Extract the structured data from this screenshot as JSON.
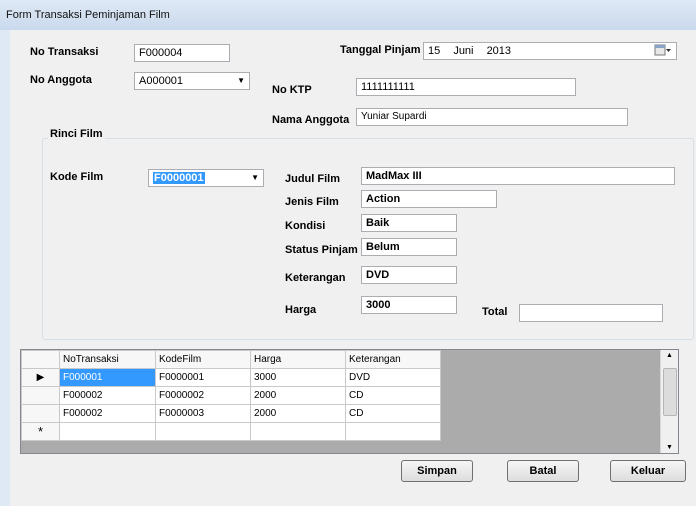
{
  "window": {
    "title": "Form Transaksi Peminjaman Film"
  },
  "form": {
    "no_transaksi_label": "No Transaksi",
    "no_transaksi_value": "F000004",
    "tanggal_label": "Tanggal Pinjam",
    "tanggal_day": "15",
    "tanggal_month": "Juni",
    "tanggal_year": "2013",
    "no_anggota_label": "No Anggota",
    "no_anggota_value": "A000001",
    "no_ktp_label": "No KTP",
    "no_ktp_value": "1111111111",
    "nama_label": "Nama Anggota",
    "nama_value": "Yuniar Supardi"
  },
  "rinci": {
    "group_title": "Rinci Film",
    "kode_label": "Kode Film",
    "kode_value": "F0000001",
    "judul_label": "Judul Film",
    "judul_value": "MadMax III",
    "jenis_label": "Jenis Film",
    "jenis_value": "Action",
    "kondisi_label": "Kondisi",
    "kondisi_value": "Baik",
    "status_label": "Status Pinjam",
    "status_value": "Belum",
    "keterangan_label": "Keterangan",
    "keterangan_value": "DVD",
    "harga_label": "Harga",
    "harga_value": "3000",
    "total_label": "Total",
    "total_value": ""
  },
  "grid": {
    "columns": [
      "NoTransaksi",
      "KodeFilm",
      "Harga",
      "Keterangan"
    ],
    "rows": [
      [
        "F000001",
        "F0000001",
        "3000",
        "DVD"
      ],
      [
        "F000002",
        "F0000002",
        "2000",
        "CD"
      ],
      [
        "F000002",
        "F0000003",
        "2000",
        "CD"
      ]
    ],
    "current_row_marker": "▶",
    "new_row_marker": "*"
  },
  "buttons": {
    "simpan": "Simpan",
    "batal": "Batal",
    "keluar": "Keluar"
  },
  "icons": {
    "calendar": "calendar-icon",
    "dropdown": "chevron-down-icon"
  }
}
